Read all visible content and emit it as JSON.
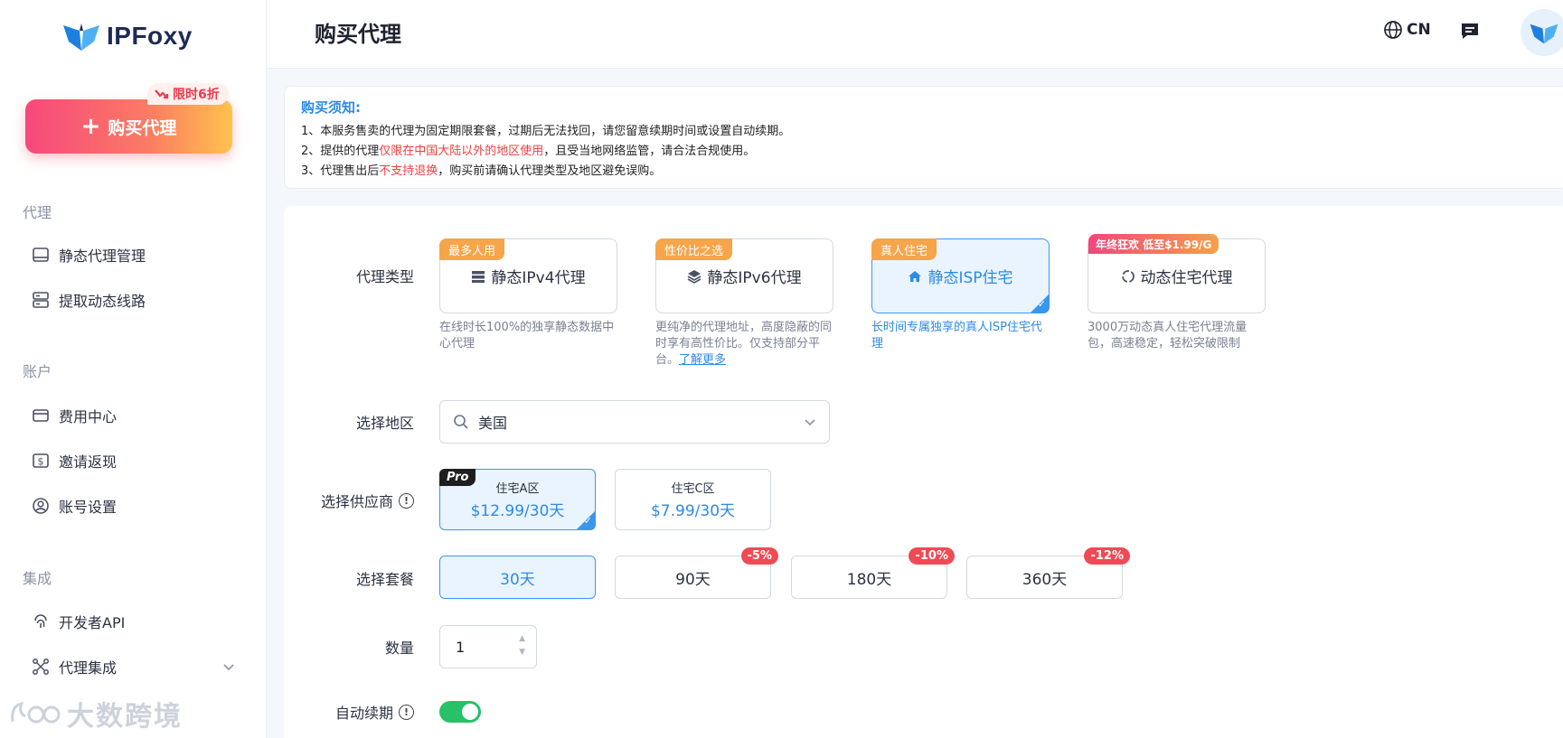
{
  "brand": {
    "name": "IPFoxy"
  },
  "sidebar": {
    "buy_button": "购买代理",
    "promo_tag": "限时6折",
    "sections": [
      {
        "title": "代理",
        "items": [
          {
            "label": "静态代理管理",
            "icon": "monitor-icon"
          },
          {
            "label": "提取动态线路",
            "icon": "server-icon"
          }
        ]
      },
      {
        "title": "账户",
        "items": [
          {
            "label": "费用中心",
            "icon": "wallet-icon"
          },
          {
            "label": "邀请返现",
            "icon": "dollar-icon"
          },
          {
            "label": "账号设置",
            "icon": "user-circle-icon"
          }
        ]
      },
      {
        "title": "集成",
        "items": [
          {
            "label": "开发者API",
            "icon": "fingerprint-icon"
          },
          {
            "label": "代理集成",
            "icon": "integration-icon"
          }
        ]
      }
    ],
    "watermark": "大数跨境"
  },
  "header": {
    "title": "购买代理",
    "lang": "CN"
  },
  "notice": {
    "title": "购买须知:",
    "line1": "1、本服务售卖的代理为固定期限套餐，过期后无法找回，请您留意续期时间或设置自动续期。",
    "line2_a": "2、提供的代理",
    "line2_red": "仅限在中国大陆以外的地区使用",
    "line2_b": "，且受当地网络监管，请合法合规使用。",
    "line3_a": "3、代理售出后",
    "line3_red": "不支持退换",
    "line3_b": "，购买前请确认代理类型及地区避免误购。"
  },
  "form": {
    "labels": {
      "type": "代理类型",
      "region": "选择地区",
      "supplier": "选择供应商",
      "plan": "选择套餐",
      "quantity": "数量",
      "auto_renew": "自动续期"
    },
    "types": [
      {
        "tag": "最多人用",
        "name": "静态IPv4代理",
        "desc": "在线时长100%的独享静态数据中心代理"
      },
      {
        "tag": "性价比之选",
        "name": "静态IPv6代理",
        "desc": "更纯净的代理地址，高度隐蔽的同时享有高性价比。仅支持部分平台。",
        "link": "了解更多"
      },
      {
        "tag": "真人住宅",
        "name": "静态ISP住宅",
        "desc": "长时间专属独享的真人ISP住宅代理"
      },
      {
        "tag": "年终狂欢 低至$1.99/G",
        "name": "动态住宅代理",
        "desc": "3000万动态真人住宅代理流量包，高速稳定，轻松突破限制"
      }
    ],
    "selected_type": 2,
    "region": "美国",
    "suppliers": [
      {
        "name": "住宅A区",
        "price": "$12.99/30天",
        "badge": "Pro"
      },
      {
        "name": "住宅C区",
        "price": "$7.99/30天"
      }
    ],
    "plans": [
      {
        "label": "30天"
      },
      {
        "label": "90天",
        "discount": "-5%"
      },
      {
        "label": "180天",
        "discount": "-10%"
      },
      {
        "label": "360天",
        "discount": "-12%"
      }
    ],
    "quantity": "1",
    "auto_renew": true
  },
  "colors": {
    "accent": "#2b8be6",
    "danger": "#ef3f3f",
    "toggle_on": "#27c167"
  }
}
